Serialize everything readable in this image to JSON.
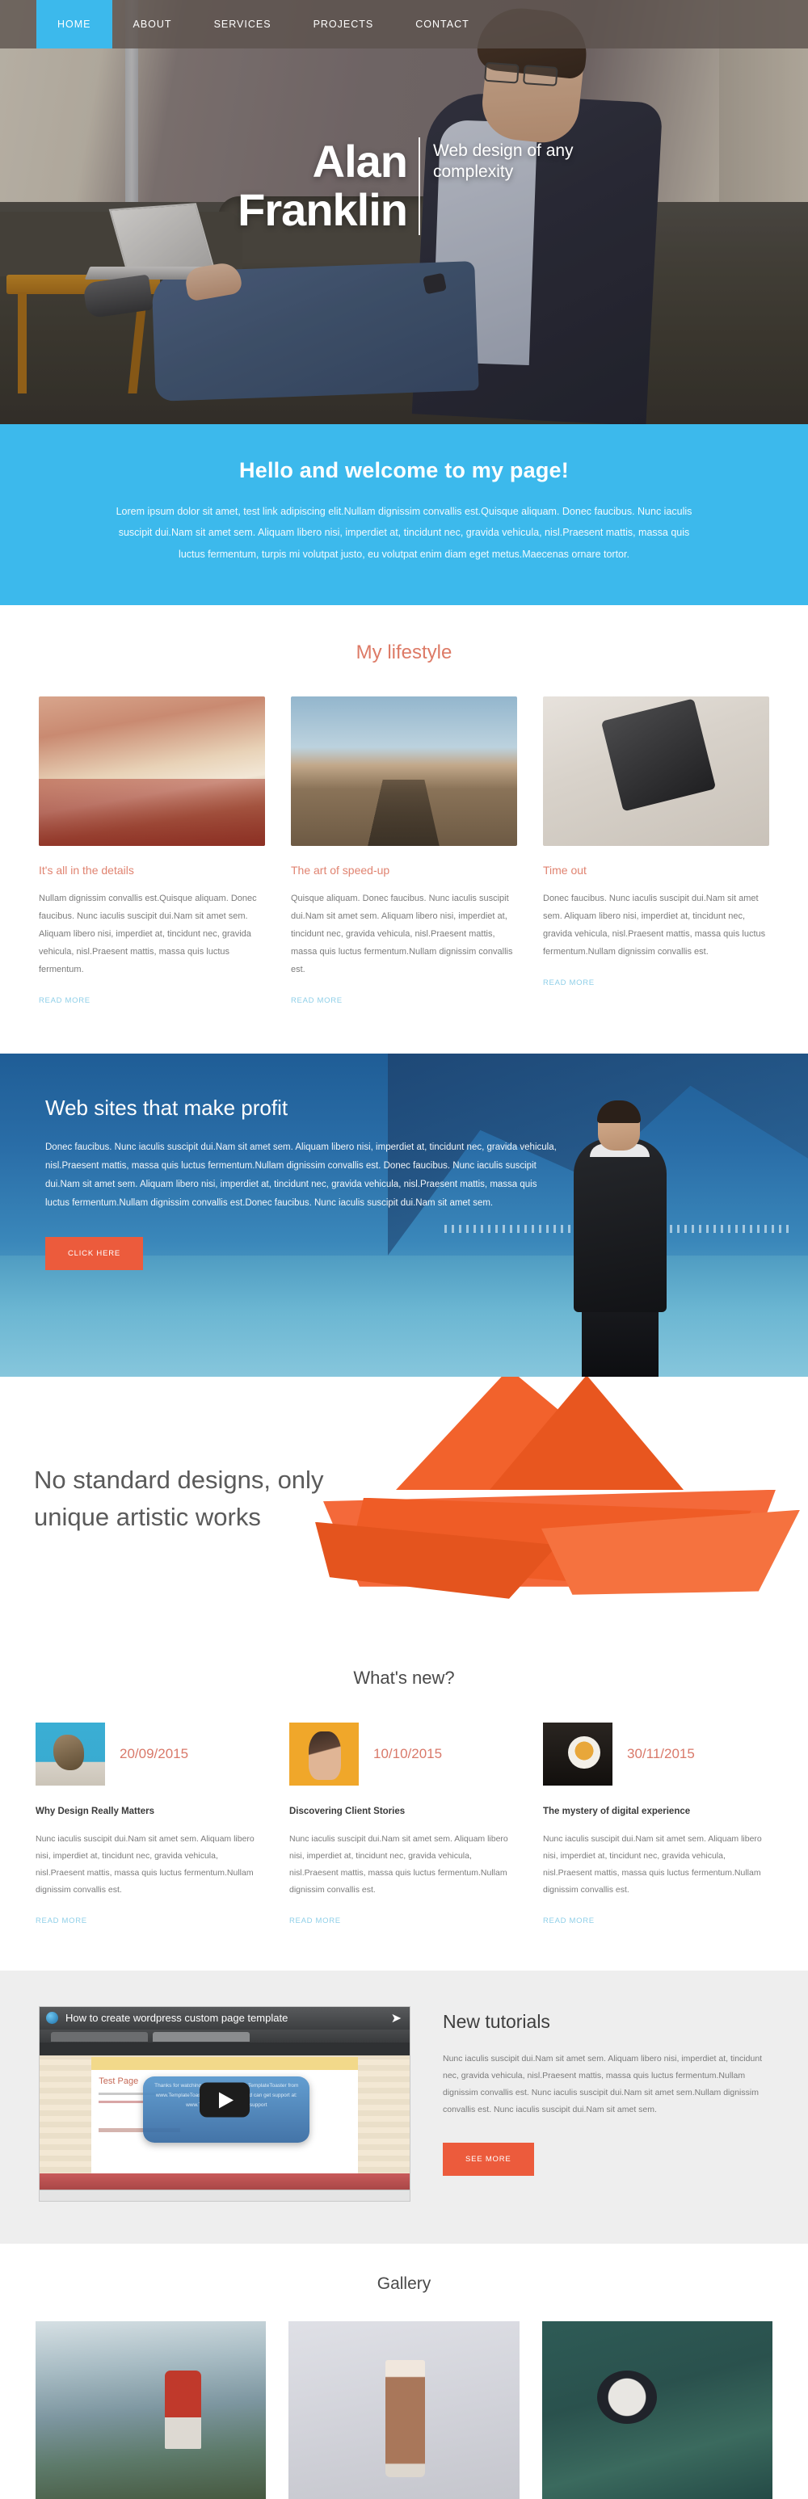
{
  "nav": {
    "items": [
      {
        "label": "HOME",
        "active": true
      },
      {
        "label": "ABOUT",
        "active": false
      },
      {
        "label": "SERVICES",
        "active": false
      },
      {
        "label": "PROJECTS",
        "active": false
      },
      {
        "label": "CONTACT",
        "active": false
      }
    ]
  },
  "hero": {
    "name_line1": "Alan",
    "name_line2": "Franklin",
    "tagline": "Web design of any complexity"
  },
  "welcome": {
    "heading": "Hello and welcome to my page!",
    "body": "Lorem ipsum dolor sit amet, test link adipiscing elit.Nullam dignissim convallis est.Quisque aliquam. Donec faucibus. Nunc iaculis suscipit dui.Nam sit amet sem. Aliquam libero nisi, imperdiet at, tincidunt nec, gravida vehicula, nisl.Praesent mattis, massa quis luctus fermentum, turpis mi volutpat justo, eu volutpat enim diam eget metus.Maecenas ornare tortor."
  },
  "lifestyle": {
    "title": "My lifestyle",
    "read_more": "READ MORE",
    "cards": [
      {
        "image": "autumn-forest-path-photo",
        "title": "It's all in the details",
        "body": "Nullam dignissim convallis est.Quisque aliquam. Donec faucibus. Nunc iaculis suscipit dui.Nam sit amet sem. Aliquam libero nisi, imperdiet at, tincidunt nec, gravida vehicula, nisl.Praesent mattis, massa quis luctus fermentum."
      },
      {
        "image": "railway-track-person-photo",
        "title": "The art of speed-up",
        "body": "Quisque aliquam. Donec faucibus. Nunc iaculis suscipit dui.Nam sit amet sem. Aliquam libero nisi, imperdiet at, tincidunt nec, gravida vehicula, nisl.Praesent mattis, massa quis luctus fermentum.Nullam dignissim convallis est."
      },
      {
        "image": "hand-holding-smartphone-photo",
        "title": "Time out",
        "body": "Donec faucibus. Nunc iaculis suscipit dui.Nam sit amet sem. Aliquam libero nisi, imperdiet at, tincidunt nec, gravida vehicula, nisl.Praesent mattis, massa quis luctus fermentum.Nullam dignissim convallis est."
      }
    ]
  },
  "profit": {
    "heading": "Web sites that make profit",
    "body": "Donec faucibus. Nunc iaculis suscipit dui.Nam sit amet sem. Aliquam libero nisi, imperdiet at, tincidunt nec, gravida vehicula, nisl.Praesent mattis, massa quis luctus fermentum.Nullam dignissim convallis est. Donec faucibus. Nunc iaculis suscipit dui.Nam sit amet sem. Aliquam libero nisi, imperdiet at, tincidunt nec, gravida vehicula, nisl.Praesent mattis, massa quis luctus fermentum.Nullam dignissim convallis est.Donec faucibus. Nunc iaculis suscipit dui.Nam sit amet sem.",
    "button_label": "CLICK HERE",
    "button_color": "#ec5b3c",
    "background": "man-looking-at-lake-photo"
  },
  "designs": {
    "heading": "No standard designs, only unique artistic works",
    "illustration": "orange-origami-paper-boat",
    "illustration_color": "#f2622c"
  },
  "whats_new": {
    "title": "What's new?",
    "read_more": "READ MORE",
    "posts": [
      {
        "thumb": "sparrow-bird-photo",
        "date": "20/09/2015",
        "title": "Why Design Really Matters",
        "body": "Nunc iaculis suscipit dui.Nam sit amet sem. Aliquam libero nisi, imperdiet at, tincidunt nec, gravida vehicula, nisl.Praesent mattis, massa quis luctus fermentum.Nullam dignissim convallis est."
      },
      {
        "thumb": "surprised-girl-photo",
        "date": "10/10/2015",
        "title": "Discovering Client Stories",
        "body": "Nunc iaculis suscipit dui.Nam sit amet sem. Aliquam libero nisi, imperdiet at, tincidunt nec, gravida vehicula, nisl.Praesent mattis, massa quis luctus fermentum.Nullam dignissim convallis est."
      },
      {
        "thumb": "cup-of-coffee-photo",
        "date": "30/11/2015",
        "title": "The mystery of digital experience",
        "body": "Nunc iaculis suscipit dui.Nam sit amet sem. Aliquam libero nisi, imperdiet at, tincidunt nec, gravida vehicula, nisl.Praesent mattis, massa quis luctus fermentum.Nullam dignissim convallis est."
      }
    ]
  },
  "tutorials": {
    "heading": "New tutorials",
    "body": "Nunc iaculis suscipit dui.Nam sit amet sem. Aliquam libero nisi, imperdiet at, tincidunt nec, gravida vehicula, nisl.Praesent mattis, massa quis luctus fermentum.Nullam dignissim convallis est. Nunc iaculis suscipit dui.Nam sit amet sem.Nullam dignissim convallis est. Nunc iaculis suscipit dui.Nam sit amet sem.",
    "button_label": "SEE MORE",
    "video": {
      "title": "How to create wordpress custom page template",
      "page_heading": "Test Page",
      "overlay_text": "Thanks for watching, you can download TemplateToaster from www.TemplateToaster.com/download and can get support at: www.TemplateToaster.com/support",
      "play_icon": "play-button-icon"
    }
  },
  "gallery": {
    "title": "Gallery",
    "items": [
      {
        "image": "hiker-on-mountain-photo"
      },
      {
        "image": "latte-glass-on-desk-photo"
      },
      {
        "image": "wristwatch-on-hand-photo"
      }
    ]
  },
  "colors": {
    "accent_blue": "#3cb9ec",
    "accent_orange": "#ec5b3c",
    "accent_salmon": "#dd7a66",
    "nav_bg": "#5c524e"
  }
}
